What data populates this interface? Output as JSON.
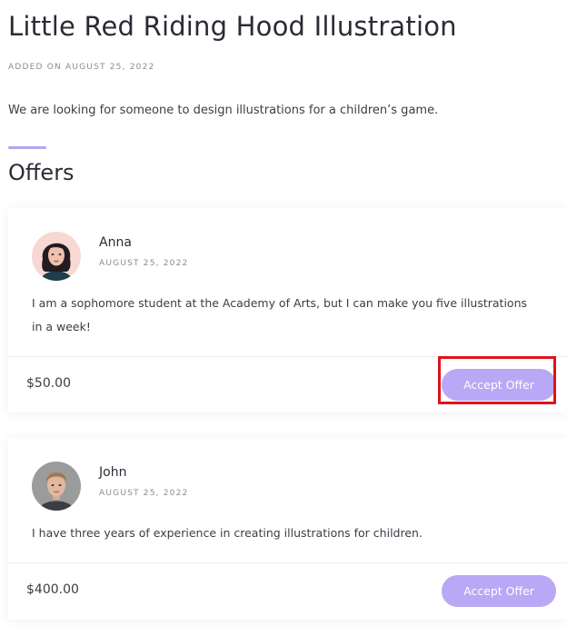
{
  "job": {
    "title": "Little Red Riding Hood Illustration",
    "added_on": "ADDED ON AUGUST 25, 2022",
    "description": "We are looking for someone to design illustrations for a children’s game."
  },
  "offers_heading": "Offers",
  "offers": [
    {
      "name": "Anna",
      "date": "AUGUST 25, 2022",
      "message": "I am a sophomore student at the Academy of Arts, but I can make you five illustrations in a week!",
      "price": "$50.00",
      "accept_label": "Accept Offer"
    },
    {
      "name": "John",
      "date": "AUGUST 25, 2022",
      "message": "I have three years of experience in creating illustrations for children.",
      "price": "$400.00",
      "accept_label": "Accept Offer"
    }
  ],
  "colors": {
    "accent": "#b3a6f2",
    "button": "#b9a8f5",
    "highlight": "#e0121b"
  }
}
